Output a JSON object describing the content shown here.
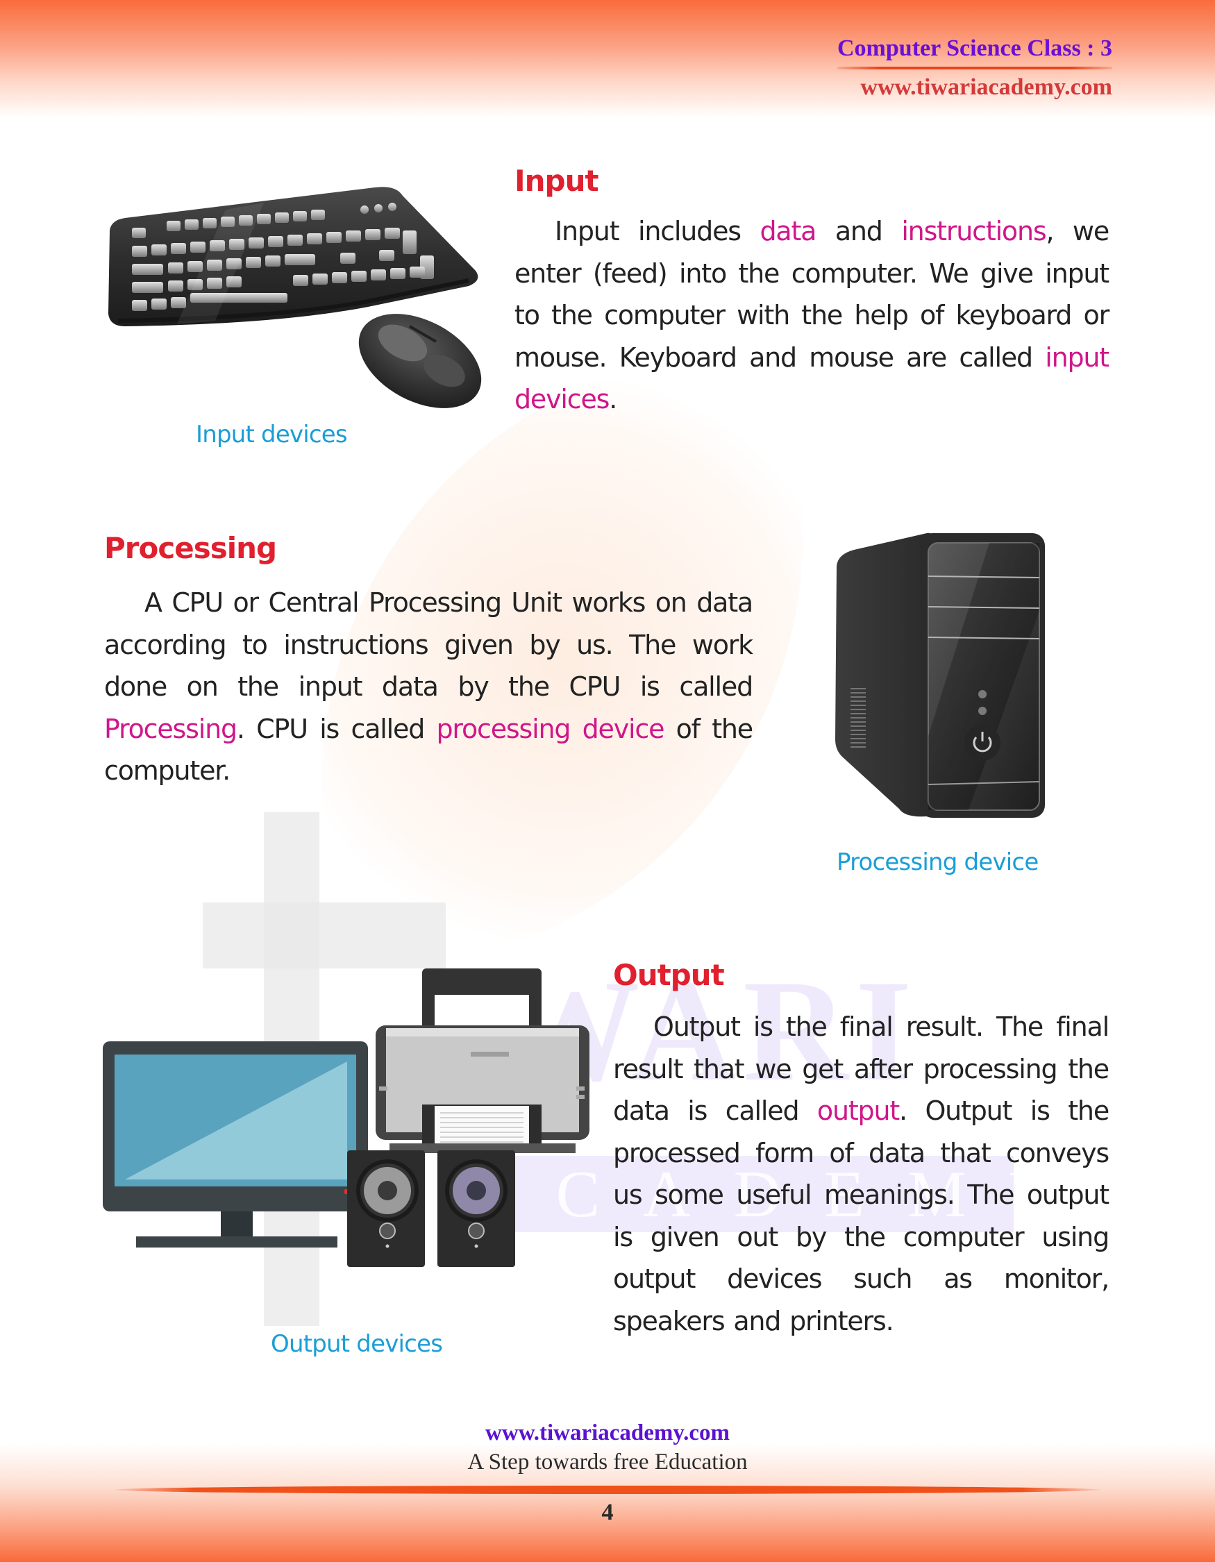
{
  "header": {
    "title": "Computer Science Class : 3",
    "url": "www.tiwariacademy.com"
  },
  "watermark": {
    "word": "IWARI",
    "subword": "ACADEMY"
  },
  "sections": {
    "input": {
      "heading": "Input",
      "body": [
        {
          "t": "Input includes "
        },
        {
          "t": "data",
          "hl": true
        },
        {
          "t": " and "
        },
        {
          "t": "instructions",
          "hl": true
        },
        {
          "t": ", we enter (feed) into the computer. We give input to the computer with the help of keyboard or mouse. Keyboard and mouse are called "
        },
        {
          "t": "input devices",
          "hl": true
        },
        {
          "t": "."
        }
      ],
      "image_icon": "keyboard-and-mouse-icon",
      "caption": "Input devices"
    },
    "processing": {
      "heading": "Processing",
      "body": [
        {
          "t": "A CPU or Central Processing Unit works on data according to instructions given by us. The work done on the input data by the CPU is called "
        },
        {
          "t": "Processing",
          "hl": true
        },
        {
          "t": ". CPU is called "
        },
        {
          "t": "processing device",
          "hl": true
        },
        {
          "t": " of the computer."
        }
      ],
      "image_icon": "cpu-tower-icon",
      "caption": "Processing device"
    },
    "output": {
      "heading": "Output",
      "body": [
        {
          "t": "Output is the final result. The final result that we get after processing the data is called "
        },
        {
          "t": "output",
          "hl": true
        },
        {
          "t": ". Output is the processed form of data that conveys us some useful meanings. The output is given out by the computer using output devices such as monitor, speakers and printers."
        }
      ],
      "image_icon": "monitor-printer-speakers-icon",
      "caption": "Output devices"
    }
  },
  "footer": {
    "url": "www.tiwariacademy.com",
    "tagline": "A Step towards free Education",
    "page_number": "4"
  },
  "colors": {
    "heading": "#e0202e",
    "highlight": "#d0168a",
    "caption": "#1a9ed6",
    "header_title": "#6a0fd6",
    "header_url": "#d43a3a",
    "band": "#f96c3c"
  }
}
